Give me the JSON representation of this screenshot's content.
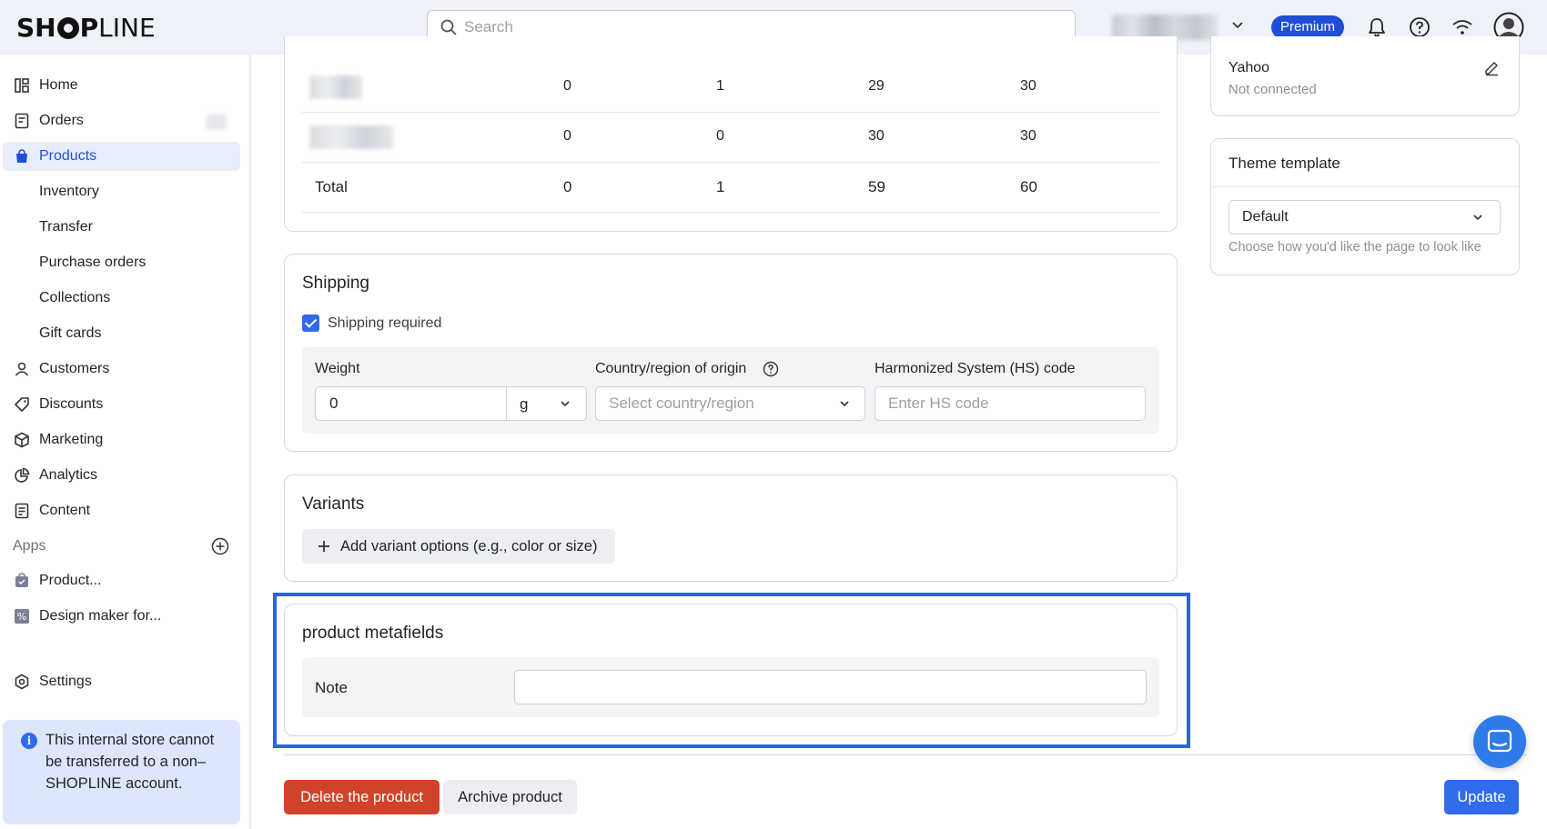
{
  "header": {
    "logo": {
      "bold_before": "SH",
      "bold_after": "P",
      "light": "LINE"
    },
    "search_placeholder": "Search",
    "plan_badge": "Premium"
  },
  "sidebar": {
    "items": [
      {
        "label": "Home",
        "icon": "home-icon"
      },
      {
        "label": "Orders",
        "icon": "orders-icon"
      },
      {
        "label": "Products",
        "icon": "products-icon",
        "active": true
      },
      {
        "label": "Inventory"
      },
      {
        "label": "Transfer"
      },
      {
        "label": "Purchase orders"
      },
      {
        "label": "Collections"
      },
      {
        "label": "Gift cards"
      },
      {
        "label": "Customers",
        "icon": "customers-icon"
      },
      {
        "label": "Discounts",
        "icon": "discounts-icon"
      },
      {
        "label": "Marketing",
        "icon": "marketing-icon"
      },
      {
        "label": "Analytics",
        "icon": "analytics-icon"
      },
      {
        "label": "Content",
        "icon": "content-icon"
      }
    ],
    "apps_label": "Apps",
    "apps": [
      {
        "label": "Product..."
      },
      {
        "label": "Design maker for..."
      }
    ],
    "settings_label": "Settings",
    "info_text": "This internal store cannot be transferred to a non–SHOPLINE account."
  },
  "inventory": {
    "rows": [
      {
        "cols": [
          "0",
          "1",
          "29",
          "30"
        ]
      },
      {
        "cols": [
          "0",
          "0",
          "30",
          "30"
        ]
      }
    ],
    "total": {
      "label": "Total",
      "cols": [
        "0",
        "1",
        "59",
        "60"
      ]
    }
  },
  "shipping": {
    "title": "Shipping",
    "shipping_required_label": "Shipping required",
    "weight_label": "Weight",
    "weight_value": "0",
    "weight_unit": "g",
    "country_label": "Country/region of origin",
    "country_placeholder": "Select country/region",
    "hs_label": "Harmonized System (HS) code",
    "hs_placeholder": "Enter HS code"
  },
  "variants": {
    "title": "Variants",
    "add_button": "Add variant options (e.g., color or size)"
  },
  "metafields": {
    "title": "product metafields",
    "note_label": "Note",
    "note_value": ""
  },
  "right_panel": {
    "channel_name": "Yahoo",
    "channel_status": "Not connected",
    "theme_title": "Theme template",
    "theme_value": "Default",
    "theme_help": "Choose how you'd like the page to look like"
  },
  "footer": {
    "delete_button": "Delete the product",
    "archive_button": "Archive product",
    "update_button": "Update"
  },
  "colors": {
    "accent": "#2f6bec",
    "danger": "#d0432a",
    "highlight_border": "#2962e6"
  }
}
